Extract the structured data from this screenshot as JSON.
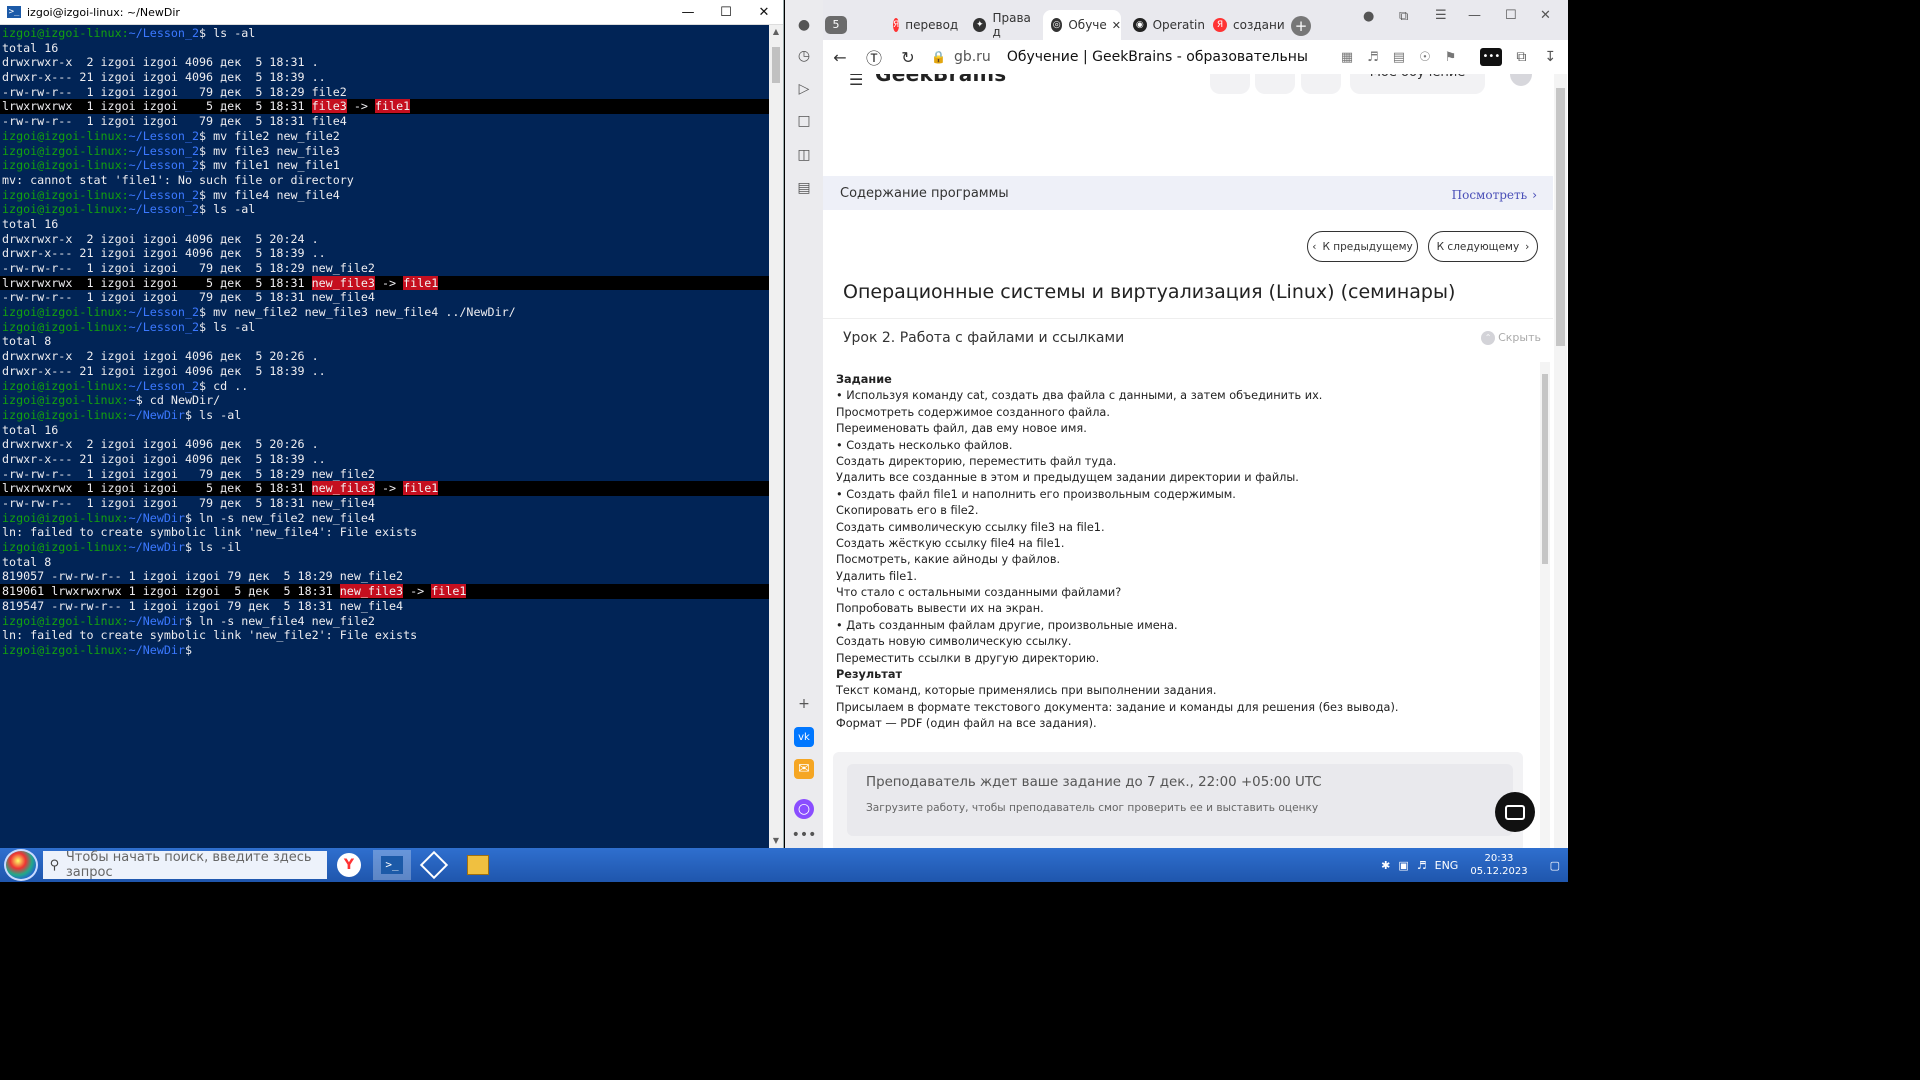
{
  "terminal": {
    "title": "izgoi@izgoi-linux: ~/NewDir",
    "lines": [
      [
        [
          "p-user",
          "izgoi@izgoi-linux:"
        ],
        [
          "p-path",
          "~/Lesson_2"
        ],
        [
          "",
          "$ ls -al"
        ]
      ],
      [
        [
          "",
          "total 16"
        ]
      ],
      [
        [
          "",
          "drwxrwxr-x  2 izgoi izgoi 4096 дек  5 18:31 ."
        ]
      ],
      [
        [
          "",
          "drwxr-x--- 21 izgoi izgoi 4096 дек  5 18:39 .."
        ]
      ],
      [
        [
          "",
          "-rw-rw-r--  1 izgoi izgoi   79 дек  5 18:29 file2"
        ]
      ],
      {
        "hl": true,
        "parts": [
          [
            "",
            "lrwxrwxrwx  1 izgoi izgoi    5 дек  5 18:31 "
          ],
          [
            "red",
            "file3"
          ],
          [
            "",
            " -> "
          ],
          [
            "red",
            "file1"
          ]
        ]
      },
      [
        [
          "",
          "-rw-rw-r--  1 izgoi izgoi   79 дек  5 18:31 file4"
        ]
      ],
      [
        [
          "p-user",
          "izgoi@izgoi-linux:"
        ],
        [
          "p-path",
          "~/Lesson_2"
        ],
        [
          "",
          "$ mv file2 new_file2"
        ]
      ],
      [
        [
          "p-user",
          "izgoi@izgoi-linux:"
        ],
        [
          "p-path",
          "~/Lesson_2"
        ],
        [
          "",
          "$ mv file3 new_file3"
        ]
      ],
      [
        [
          "p-user",
          "izgoi@izgoi-linux:"
        ],
        [
          "p-path",
          "~/Lesson_2"
        ],
        [
          "",
          "$ mv file1 new_file1"
        ]
      ],
      [
        [
          "",
          "mv: cannot stat 'file1': No such file or directory"
        ]
      ],
      [
        [
          "p-user",
          "izgoi@izgoi-linux:"
        ],
        [
          "p-path",
          "~/Lesson_2"
        ],
        [
          "",
          "$ mv file4 new_file4"
        ]
      ],
      [
        [
          "p-user",
          "izgoi@izgoi-linux:"
        ],
        [
          "p-path",
          "~/Lesson_2"
        ],
        [
          "",
          "$ ls -al"
        ]
      ],
      [
        [
          "",
          "total 16"
        ]
      ],
      [
        [
          "",
          "drwxrwxr-x  2 izgoi izgoi 4096 дек  5 20:24 ."
        ]
      ],
      [
        [
          "",
          "drwxr-x--- 21 izgoi izgoi 4096 дек  5 18:39 .."
        ]
      ],
      [
        [
          "",
          "-rw-rw-r--  1 izgoi izgoi   79 дек  5 18:29 new_file2"
        ]
      ],
      {
        "hl": true,
        "parts": [
          [
            "",
            "lrwxrwxrwx  1 izgoi izgoi    5 дек  5 18:31 "
          ],
          [
            "red",
            "new_file3"
          ],
          [
            "",
            " -> "
          ],
          [
            "red",
            "file1"
          ]
        ]
      },
      [
        [
          "",
          "-rw-rw-r--  1 izgoi izgoi   79 дек  5 18:31 new_file4"
        ]
      ],
      [
        [
          "p-user",
          "izgoi@izgoi-linux:"
        ],
        [
          "p-path",
          "~/Lesson_2"
        ],
        [
          "",
          "$ mv new_file2 new_file3 new_file4 ../NewDir/"
        ]
      ],
      [
        [
          "p-user",
          "izgoi@izgoi-linux:"
        ],
        [
          "p-path",
          "~/Lesson_2"
        ],
        [
          "",
          "$ ls -al"
        ]
      ],
      [
        [
          "",
          "total 8"
        ]
      ],
      [
        [
          "",
          "drwxrwxr-x  2 izgoi izgoi 4096 дек  5 20:26 ."
        ]
      ],
      [
        [
          "",
          "drwxr-x--- 21 izgoi izgoi 4096 дек  5 18:39 .."
        ]
      ],
      [
        [
          "p-user",
          "izgoi@izgoi-linux:"
        ],
        [
          "p-path",
          "~/Lesson_2"
        ],
        [
          "",
          "$ cd .."
        ]
      ],
      [
        [
          "p-user",
          "izgoi@izgoi-linux:"
        ],
        [
          "p-path",
          "~"
        ],
        [
          "",
          "$ cd NewDir/"
        ]
      ],
      [
        [
          "p-user",
          "izgoi@izgoi-linux:"
        ],
        [
          "p-path",
          "~/NewDir"
        ],
        [
          "",
          "$ ls -al"
        ]
      ],
      [
        [
          "",
          "total 16"
        ]
      ],
      [
        [
          "",
          "drwxrwxr-x  2 izgoi izgoi 4096 дек  5 20:26 ."
        ]
      ],
      [
        [
          "",
          "drwxr-x--- 21 izgoi izgoi 4096 дек  5 18:39 .."
        ]
      ],
      [
        [
          "",
          "-rw-rw-r--  1 izgoi izgoi   79 дек  5 18:29 new_file2"
        ]
      ],
      {
        "hl": true,
        "parts": [
          [
            "",
            "lrwxrwxrwx  1 izgoi izgoi    5 дек  5 18:31 "
          ],
          [
            "red",
            "new_file3"
          ],
          [
            "",
            " -> "
          ],
          [
            "red",
            "file1"
          ]
        ]
      },
      [
        [
          "",
          "-rw-rw-r--  1 izgoi izgoi   79 дек  5 18:31 new_file4"
        ]
      ],
      [
        [
          "p-user",
          "izgoi@izgoi-linux:"
        ],
        [
          "p-path",
          "~/NewDir"
        ],
        [
          "",
          "$ ln -s new_file2 new_file4"
        ]
      ],
      [
        [
          "",
          "ln: failed to create symbolic link 'new_file4': File exists"
        ]
      ],
      [
        [
          "p-user",
          "izgoi@izgoi-linux:"
        ],
        [
          "p-path",
          "~/NewDir"
        ],
        [
          "",
          "$ ls -il"
        ]
      ],
      [
        [
          "",
          "total 8"
        ]
      ],
      [
        [
          "",
          "819057 -rw-rw-r-- 1 izgoi izgoi 79 дек  5 18:29 new_file2"
        ]
      ],
      {
        "hl": true,
        "parts": [
          [
            "",
            "819061 lrwxrwxrwx 1 izgoi izgoi  5 дек  5 18:31 "
          ],
          [
            "red",
            "new_file3"
          ],
          [
            "",
            " -> "
          ],
          [
            "red",
            "file1"
          ]
        ]
      },
      [
        [
          "",
          "819547 -rw-rw-r-- 1 izgoi izgoi 79 дек  5 18:31 new_file4"
        ]
      ],
      [
        [
          "p-user",
          "izgoi@izgoi-linux:"
        ],
        [
          "p-path",
          "~/NewDir"
        ],
        [
          "",
          "$ ln -s new_file4 new_file2"
        ]
      ],
      [
        [
          "",
          "ln: failed to create symbolic link 'new_file2': File exists"
        ]
      ],
      [
        [
          "p-user",
          "izgoi@izgoi-linux:"
        ],
        [
          "p-path",
          "~/NewDir"
        ],
        [
          "",
          "$"
        ]
      ]
    ]
  },
  "browser": {
    "tab_count": "5",
    "tabs": [
      "перевод",
      "Права д",
      "Обуче",
      "Operatin",
      "создани"
    ],
    "domain": "gb.ru",
    "page_title": "Обучение | GeekBrains - образовательный...",
    "logo": "GeekBrains",
    "my_learning": "Мое обучение",
    "program_label": "Содержание программы",
    "program_link": "Посмотреть",
    "prev_btn": "К предыдущему",
    "next_btn": "К следующему",
    "course_title": "Операционные системы и виртуализация (Linux) (семинары)",
    "lesson_title": "Урок 2. Работа с файлами и ссылками",
    "hide_label": "Скрыть",
    "task_lines": [
      {
        "t": "Задание",
        "b": true
      },
      {
        "t": "• Используя команду cat, создать два файла с данными, а затем объединить их."
      },
      {
        "t": "Просмотреть содержимое созданного файла."
      },
      {
        "t": "Переименовать файл, дав ему новое имя."
      },
      {
        "t": "• Создать несколько файлов."
      },
      {
        "t": "Создать директорию, переместить файл туда."
      },
      {
        "t": "Удалить все созданные в этом и предыдущем задании директории и файлы."
      },
      {
        "t": "• Создать файл file1 и наполнить его произвольным содержимым."
      },
      {
        "t": "Скопировать его в file2."
      },
      {
        "t": "Создать символическую ссылку file3 на file1."
      },
      {
        "t": "Создать жёсткую ссылку file4 на file1."
      },
      {
        "t": "Посмотреть, какие айноды у файлов."
      },
      {
        "t": "Удалить file1."
      },
      {
        "t": "Что стало с остальными созданными файлами?"
      },
      {
        "t": "Попробовать вывести их на экран."
      },
      {
        "t": "• Дать созданным файлам другие, произвольные имена."
      },
      {
        "t": "Создать новую символическую ссылку."
      },
      {
        "t": "Переместить ссылки в другую директорию."
      },
      {
        "t": "Результат",
        "b": true
      },
      {
        "t": "Текст команд, которые применялись при выполнении задания."
      },
      {
        "t": "Присылаем в формате текстового документа: задание и команды для решения (без вывода)."
      },
      {
        "t": "Формат — PDF (один файл на все задания)."
      }
    ],
    "deadline": "Преподаватель ждет ваше задание до 7 дек., 22:00 +05:00 UTC",
    "deadline_sub": "Загрузите работу, чтобы преподаватель смог проверить ее и выставить оценку"
  },
  "taskbar": {
    "search_placeholder": "Чтобы начать поиск, введите здесь запрос",
    "lang": "ENG",
    "time": "20:33",
    "date": "05.12.2023"
  }
}
